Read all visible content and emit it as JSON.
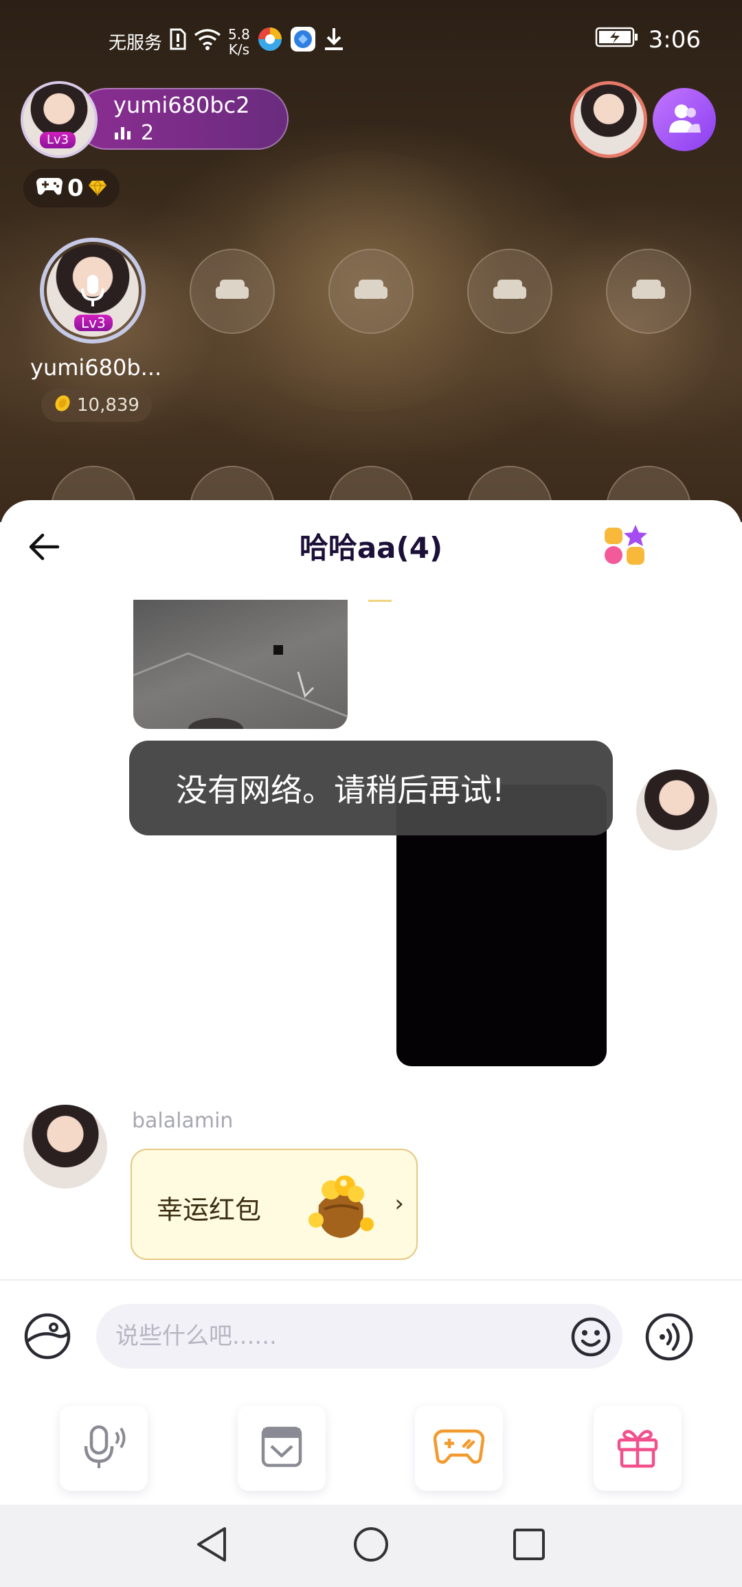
{
  "status_bar": {
    "carrier": "无服务",
    "speed_value": "5.8",
    "speed_unit": "K/s",
    "time": "3:06"
  },
  "room": {
    "host_name": "yumi680bc2",
    "host_level": "Lv3",
    "online_count": "2",
    "game_coins": "0",
    "seat_host_name": "yumi680b...",
    "seat_host_level": "Lv3",
    "seat_host_coins": "10,839"
  },
  "chat": {
    "title": "哈哈aa(4)",
    "toast": "没有网络。请稍后再试!",
    "sender_name": "balalamin",
    "red_packet_label": "幸运红包",
    "red_packet_arrow": "›"
  },
  "input": {
    "placeholder": "说些什么吧......"
  },
  "colors": {
    "accent_purple": "#8a3ff0",
    "title_color": "#1c1038",
    "red_packet_bg": "#fefbe0",
    "game_icon": "#f29a2e",
    "gift_icon": "#f2508c"
  },
  "icons": [
    "no-sim-icon",
    "wifi-icon",
    "browser-icon",
    "app-icon",
    "download-icon",
    "battery-icon",
    "signal-bars-icon",
    "gamepad-icon",
    "diamond-icon",
    "members-icon",
    "microphone-icon",
    "sofa-icon",
    "coin-icon",
    "back-arrow-icon",
    "apps-grid-icon",
    "coin-bag-icon",
    "chevron-right-icon",
    "expression-icon",
    "emoji-icon",
    "voice-icon",
    "mic-tool-icon",
    "photo-tool-icon",
    "game-tool-icon",
    "gift-icon",
    "nav-back-icon",
    "nav-home-icon",
    "nav-recents-icon"
  ]
}
